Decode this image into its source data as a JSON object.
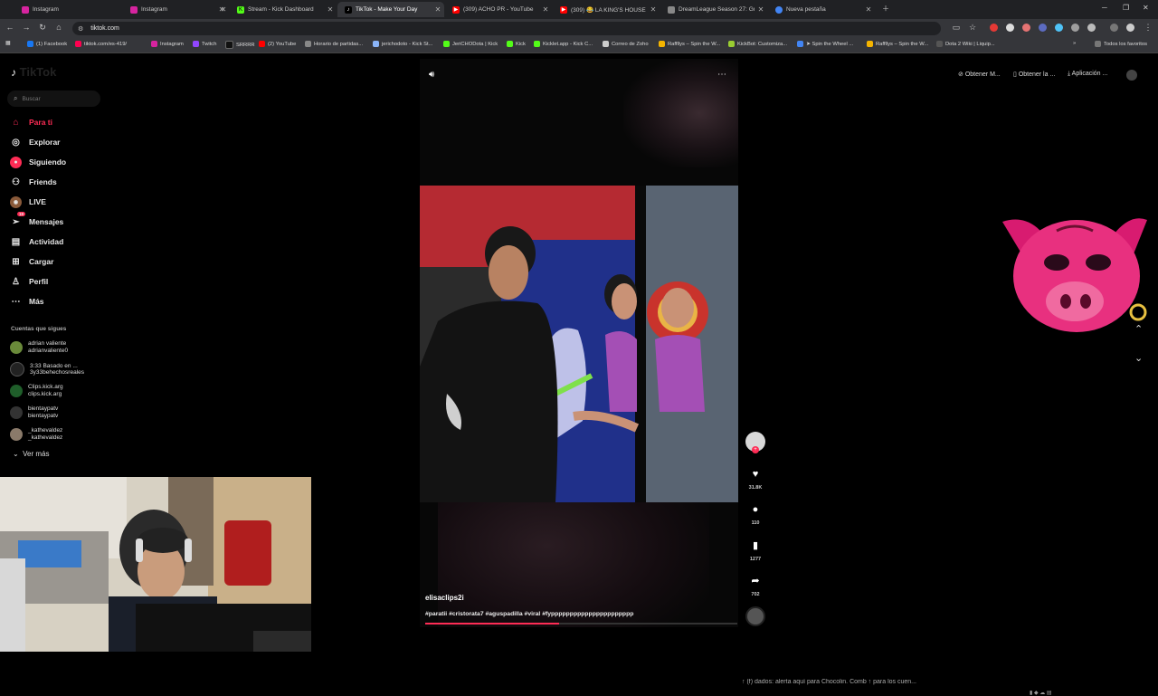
{
  "browser": {
    "tabs": [
      {
        "label": "Instagram",
        "icon": "instagram-icon",
        "color": "#d6249f"
      },
      {
        "label": "Instagram",
        "icon": "instagram-icon",
        "color": "#d6249f"
      },
      {
        "label": "Stream - Kick Dashboard",
        "icon": "kick-icon",
        "color": "#53fc18"
      },
      {
        "label": "TikTok - Make Your Day",
        "icon": "tiktok-icon",
        "color": "#000000"
      },
      {
        "label": "(309) ACHO PR - YouTube",
        "icon": "youtube-icon",
        "color": "#ff0000"
      },
      {
        "label": "(309) 😂 LA KING'S HOUSE SE",
        "icon": "youtube-icon",
        "color": "#ff0000"
      },
      {
        "label": "DreamLeague Season 27: Grou",
        "icon": "dreamleague-icon",
        "color": "#888888"
      },
      {
        "label": "Nueva pestaña",
        "icon": "chrome-icon",
        "color": "#4285f4"
      }
    ],
    "url": "tiktok.com",
    "bookmarks": [
      "(1) Facebook",
      "tiktok.com/es-419/",
      "Instagram",
      "Twitch",
      "SRRRR",
      "(2) YouTube",
      "Horario de partidas...",
      "jerichodoto - Kick St...",
      "JeriCHODota | Kick",
      "Kick",
      "Kicklet.app - Kick C...",
      "Correo de Zoho",
      "Raffllys – Spin the W...",
      "KickBot: Customiza...",
      "➤ Spin the Wheel ...",
      "Raffllys – Spin the W...",
      "Dota 2 Wiki | Liquip..."
    ],
    "bookmarks_all": "Todos los favoritos"
  },
  "tiktok": {
    "logo": "TikTok",
    "search_placeholder": "Buscar",
    "nav": [
      {
        "label": "Para ti",
        "icon": "home-icon",
        "active": true
      },
      {
        "label": "Explorar",
        "icon": "compass-icon"
      },
      {
        "label": "Siguiendo",
        "icon": "following-icon"
      },
      {
        "label": "Friends",
        "icon": "friends-icon"
      },
      {
        "label": "LIVE",
        "icon": "live-icon"
      },
      {
        "label": "Mensajes",
        "icon": "messages-icon",
        "badge": "19"
      },
      {
        "label": "Actividad",
        "icon": "activity-icon"
      },
      {
        "label": "Cargar",
        "icon": "upload-icon"
      },
      {
        "label": "Perfil",
        "icon": "profile-icon"
      },
      {
        "label": "Más",
        "icon": "more-icon"
      }
    ],
    "following_title": "Cuentas que sigues",
    "following": [
      {
        "name": "adrian valiente",
        "handle": "adrianvaliente0",
        "color": "#6a8a3a"
      },
      {
        "name": "3:33 Basado en ...",
        "handle": "3y33behechosreales",
        "color": "#222222"
      },
      {
        "name": "Clips.kick.arg",
        "handle": "clips.kick.arg",
        "color": "#1f5e2a"
      },
      {
        "name": "bientaypatv",
        "handle": "bientaypatv",
        "color": "#333333"
      },
      {
        "name": "_kathevaldez",
        "handle": "_kathevaldez",
        "color": "#8a7a6a"
      }
    ],
    "see_more": "Ver más",
    "top_right": {
      "coins": "Obtener M...",
      "app": "Obtener la ...",
      "install": "Aplicación ..."
    },
    "video": {
      "username": "elisaclips2i",
      "hashtags": "#paratii #cristorata7 #aguspadilla #viral #fypppppppppppppppppppppp",
      "progress": 0.43,
      "likes": "31.8K",
      "comments": "110",
      "saves": "1277",
      "shares": "702"
    }
  },
  "overlay": {
    "chat_text": "↑ (f) dados: alerta aquí para Chocolin. Comb ↑ para los cuen..."
  }
}
